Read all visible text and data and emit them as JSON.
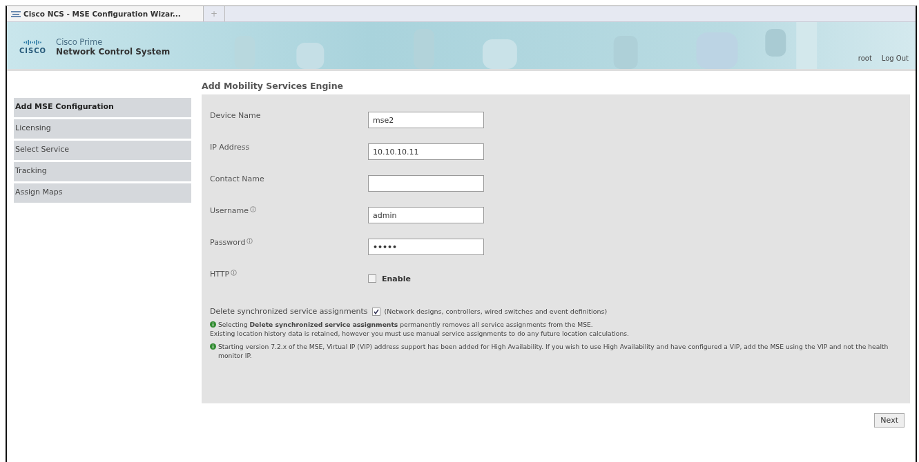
{
  "browser_tab": {
    "title": "Cisco NCS - MSE Configuration Wizar...",
    "new_tab": "+"
  },
  "header": {
    "logo_text": "CISCO",
    "product_line": "Cisco Prime",
    "product_name": "Network Control System",
    "user": "root",
    "logout": "Log Out"
  },
  "sidebar": {
    "items": [
      {
        "label": "Add MSE Configuration",
        "selected": true
      },
      {
        "label": "Licensing",
        "selected": false
      },
      {
        "label": "Select Service",
        "selected": false
      },
      {
        "label": "Tracking",
        "selected": false
      },
      {
        "label": "Assign Maps",
        "selected": false
      }
    ]
  },
  "form": {
    "title": "Add Mobility Services Engine",
    "fields": [
      {
        "kind": "text",
        "label": "Device Name",
        "info": false,
        "value": "mse2"
      },
      {
        "kind": "text",
        "label": "IP Address",
        "info": false,
        "value": "10.10.10.11"
      },
      {
        "kind": "text",
        "label": "Contact Name",
        "info": false
      },
      {
        "kind": "text",
        "label": "Username",
        "info": true,
        "value": "admin"
      },
      {
        "kind": "password",
        "label": "Password",
        "info": true,
        "value": "•••••"
      },
      {
        "kind": "checkbox",
        "label": "HTTP",
        "info": true,
        "checked": false,
        "option": "Enable"
      }
    ],
    "delete_sync": {
      "label": "Delete synchronized service assignments",
      "checked": true,
      "note": "(Network designs, controllers, wired switches and event definitions)"
    },
    "notes": [
      {
        "lines": [
          "Selecting **Delete synchronized service assignments** permanently removes all service assignments from the MSE.",
          "Existing location history data is retained, however you must use manual service assignments to do any future location calculations."
        ]
      },
      {
        "lines": [
          "Starting version 7.2.x of the MSE, Virtual IP (VIP) address support has been added for High Availability. If you wish to use High Availability and have configured a VIP, add the MSE using the VIP and not the health monitor IP."
        ]
      }
    ]
  },
  "buttons": [
    "Next"
  ]
}
